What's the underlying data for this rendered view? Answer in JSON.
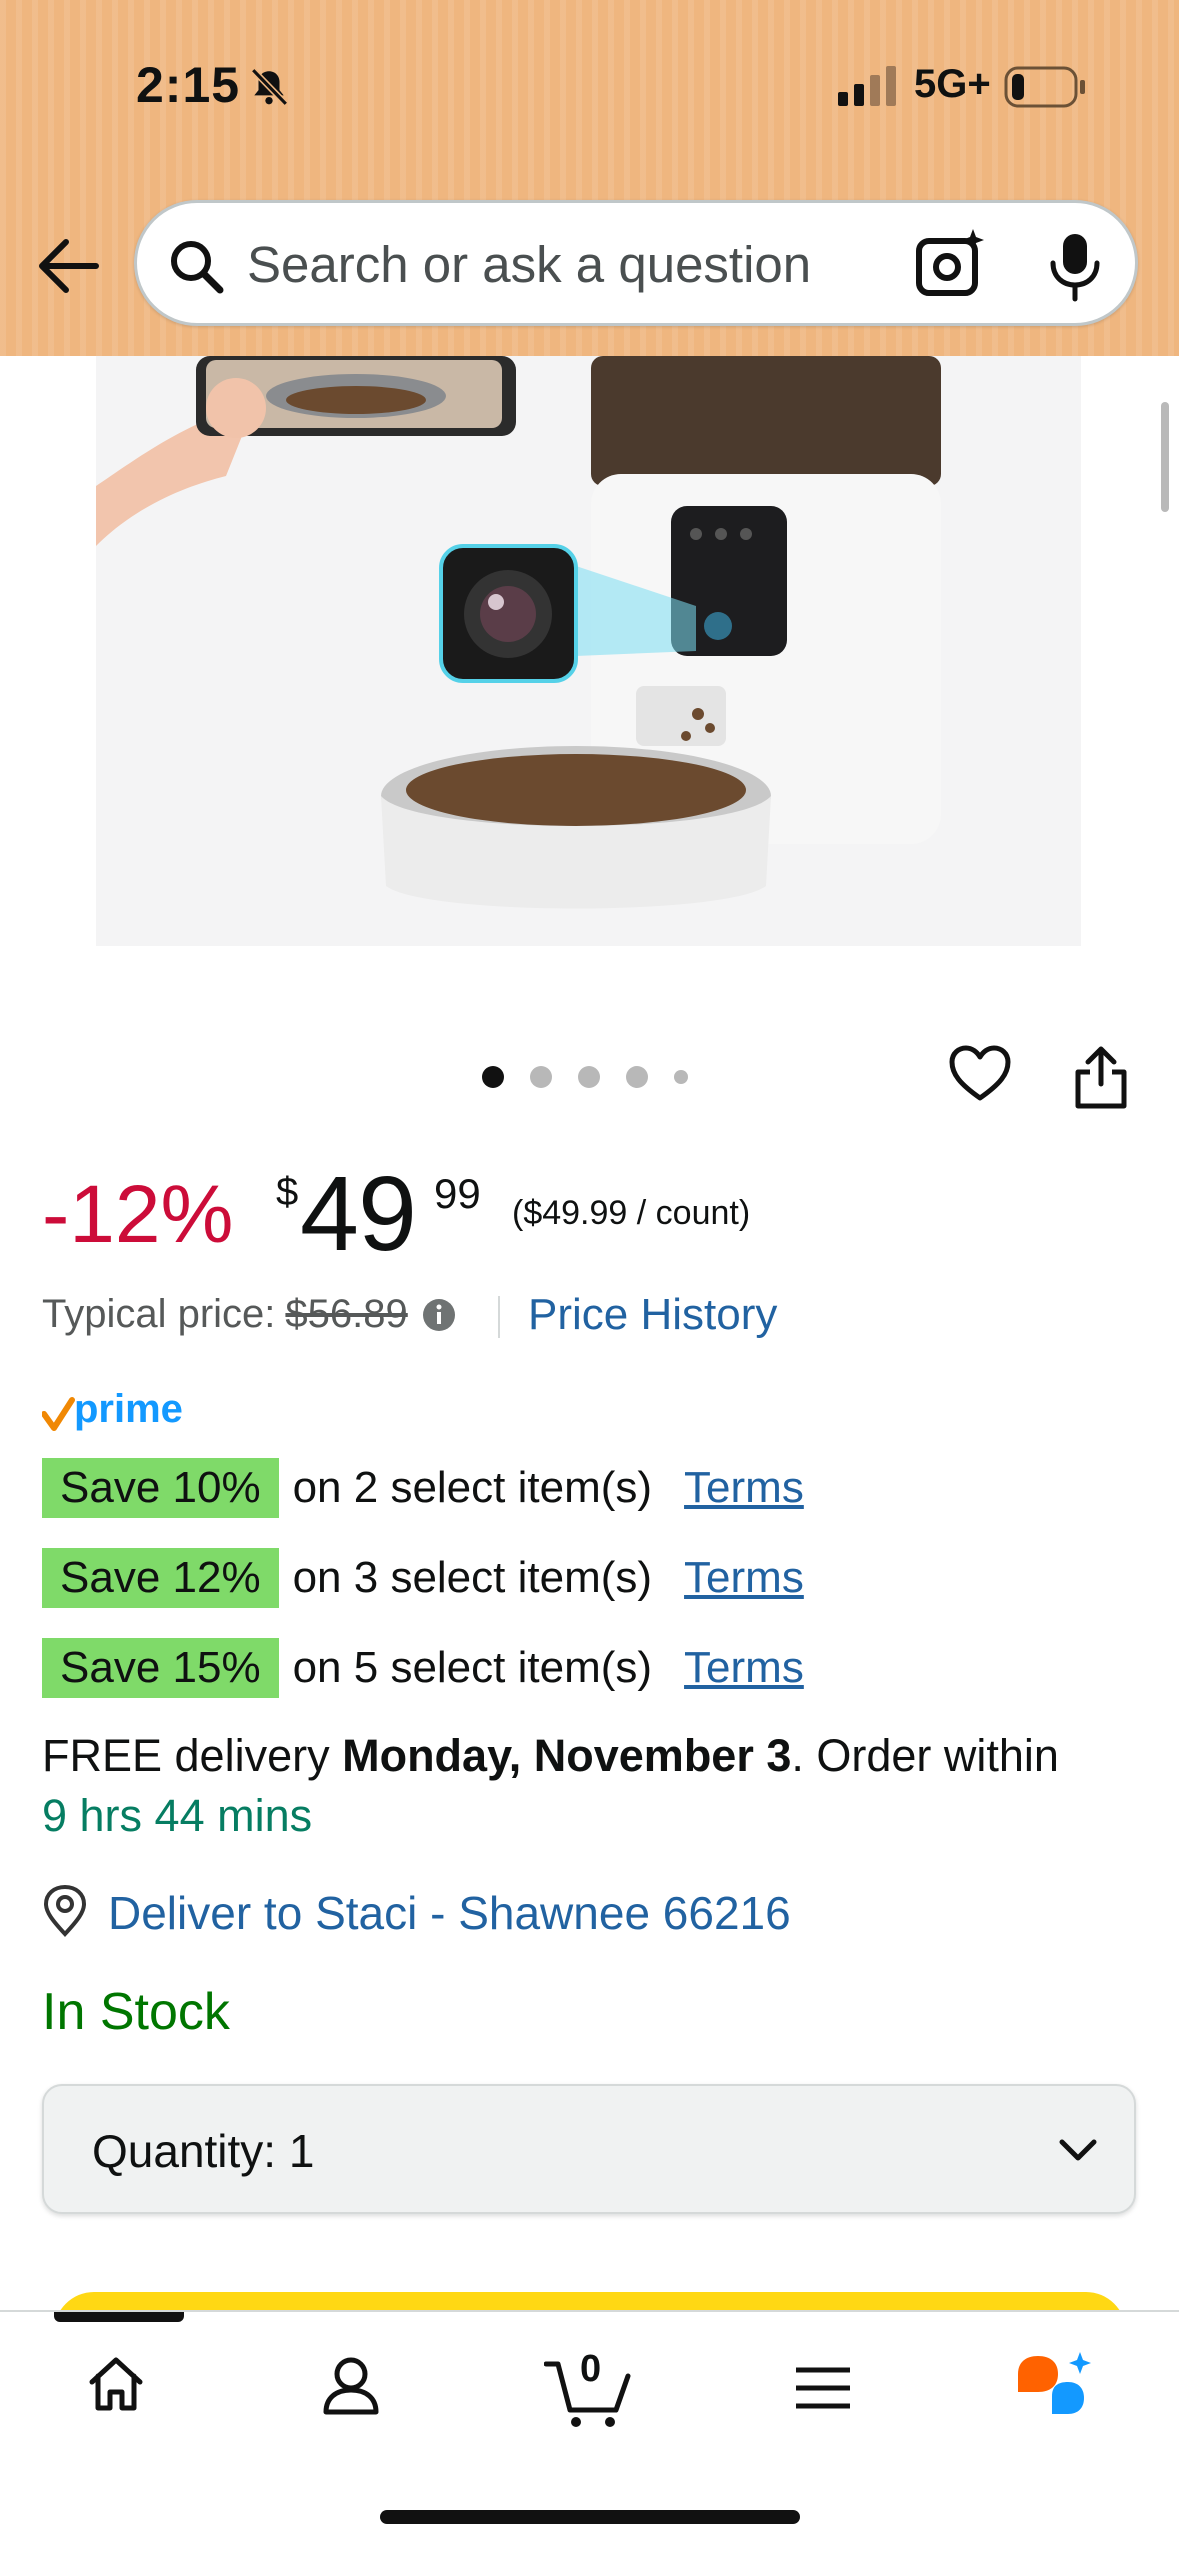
{
  "status_bar": {
    "time": "2:15",
    "network": "5G+"
  },
  "search": {
    "placeholder": "Search or ask a question"
  },
  "gallery": {
    "image_count": 5,
    "active_index": 0
  },
  "price": {
    "discount": "-12%",
    "currency": "$",
    "whole": "49",
    "fraction": "99",
    "per_unit": "($49.99 / count)",
    "typical_label": "Typical price:",
    "typical_value": "$56.89",
    "history_link": "Price History"
  },
  "prime_label": "prime",
  "deals": [
    {
      "badge": "Save 10%",
      "text": "on 2 select item(s)",
      "terms": "Terms"
    },
    {
      "badge": "Save 12%",
      "text": "on 3 select item(s)",
      "terms": "Terms"
    },
    {
      "badge": "Save 15%",
      "text": "on 5 select item(s)",
      "terms": "Terms"
    }
  ],
  "delivery": {
    "prefix": "FREE delivery ",
    "date": "Monday, November 3",
    "suffix": ". Order within ",
    "countdown": "9 hrs 44 mins",
    "deliver_to": "Deliver to Staci - Shawnee 66216"
  },
  "stock": "In Stock",
  "quantity": {
    "label": "Quantity:",
    "value": "1"
  },
  "tabbar": {
    "cart_count": "0"
  },
  "colors": {
    "header_bg": "#efb67f",
    "discount_red": "#cc0c39",
    "link_blue": "#2162a1",
    "deal_green": "#7fda69",
    "stock_green": "#007600",
    "buy_yellow": "#ffd814"
  }
}
